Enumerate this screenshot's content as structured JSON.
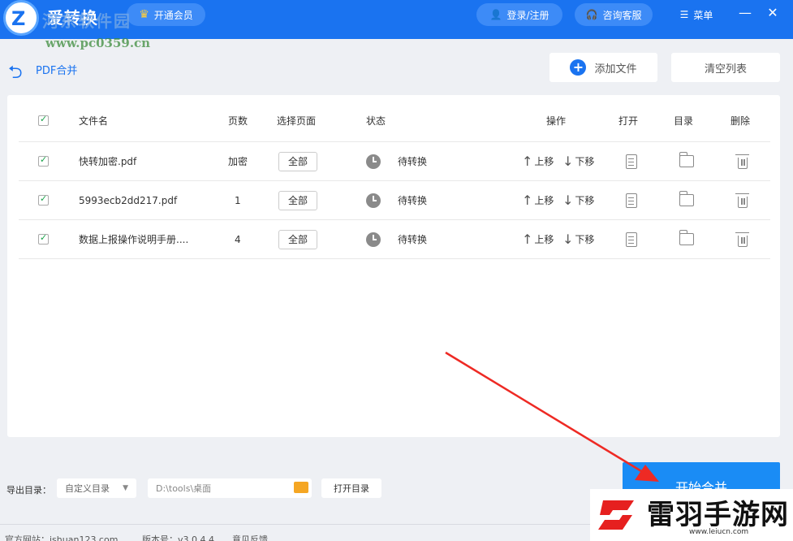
{
  "titlebar": {
    "app_title": "爱转换",
    "vip_label": "开通会员",
    "login_label": "登录/注册",
    "consult_label": "咨询客服",
    "menu_label": "菜单",
    "minimize_glyph": "—",
    "close_glyph": "✕"
  },
  "watermark": {
    "site_name": "河东软件园",
    "site_url": "www.pc0359.cn",
    "brand_name": "雷羽手游网",
    "brand_url": "www.leiucn.com"
  },
  "subheader": {
    "title": "PDF合并",
    "add_file_label": "添加文件",
    "clear_list_label": "清空列表"
  },
  "table": {
    "headers": {
      "filename": "文件名",
      "pages": "页数",
      "select_pages": "选择页面",
      "status": "状态",
      "operation": "操作",
      "open": "打开",
      "directory": "目录",
      "delete": "删除"
    },
    "move_up_label": "上移",
    "move_down_label": "下移",
    "rows": [
      {
        "filename": "快转加密.pdf",
        "pages": "加密",
        "select_pages": "全部",
        "status": "待转换",
        "checked": true
      },
      {
        "filename": "5993ecb2dd217.pdf",
        "pages": "1",
        "select_pages": "全部",
        "status": "待转换",
        "checked": true
      },
      {
        "filename": "数据上报操作说明手册....",
        "pages": "4",
        "select_pages": "全部",
        "status": "待转换",
        "checked": true
      }
    ]
  },
  "bottom": {
    "output_label": "导出目录：",
    "dir_select_value": "自定义目录",
    "path_value": "D:\\tools\\桌面",
    "open_dir_label": "打开目录",
    "start_label": "开始合并"
  },
  "footer": {
    "website": "官方网站：ishuan123.com",
    "version": "版本号：v3.0.4.4",
    "feedback": "意见反馈"
  },
  "colors": {
    "brand_blue": "#1a73f0",
    "start_button": "#1a8cf5",
    "annotation_red": "#ee2a24"
  }
}
